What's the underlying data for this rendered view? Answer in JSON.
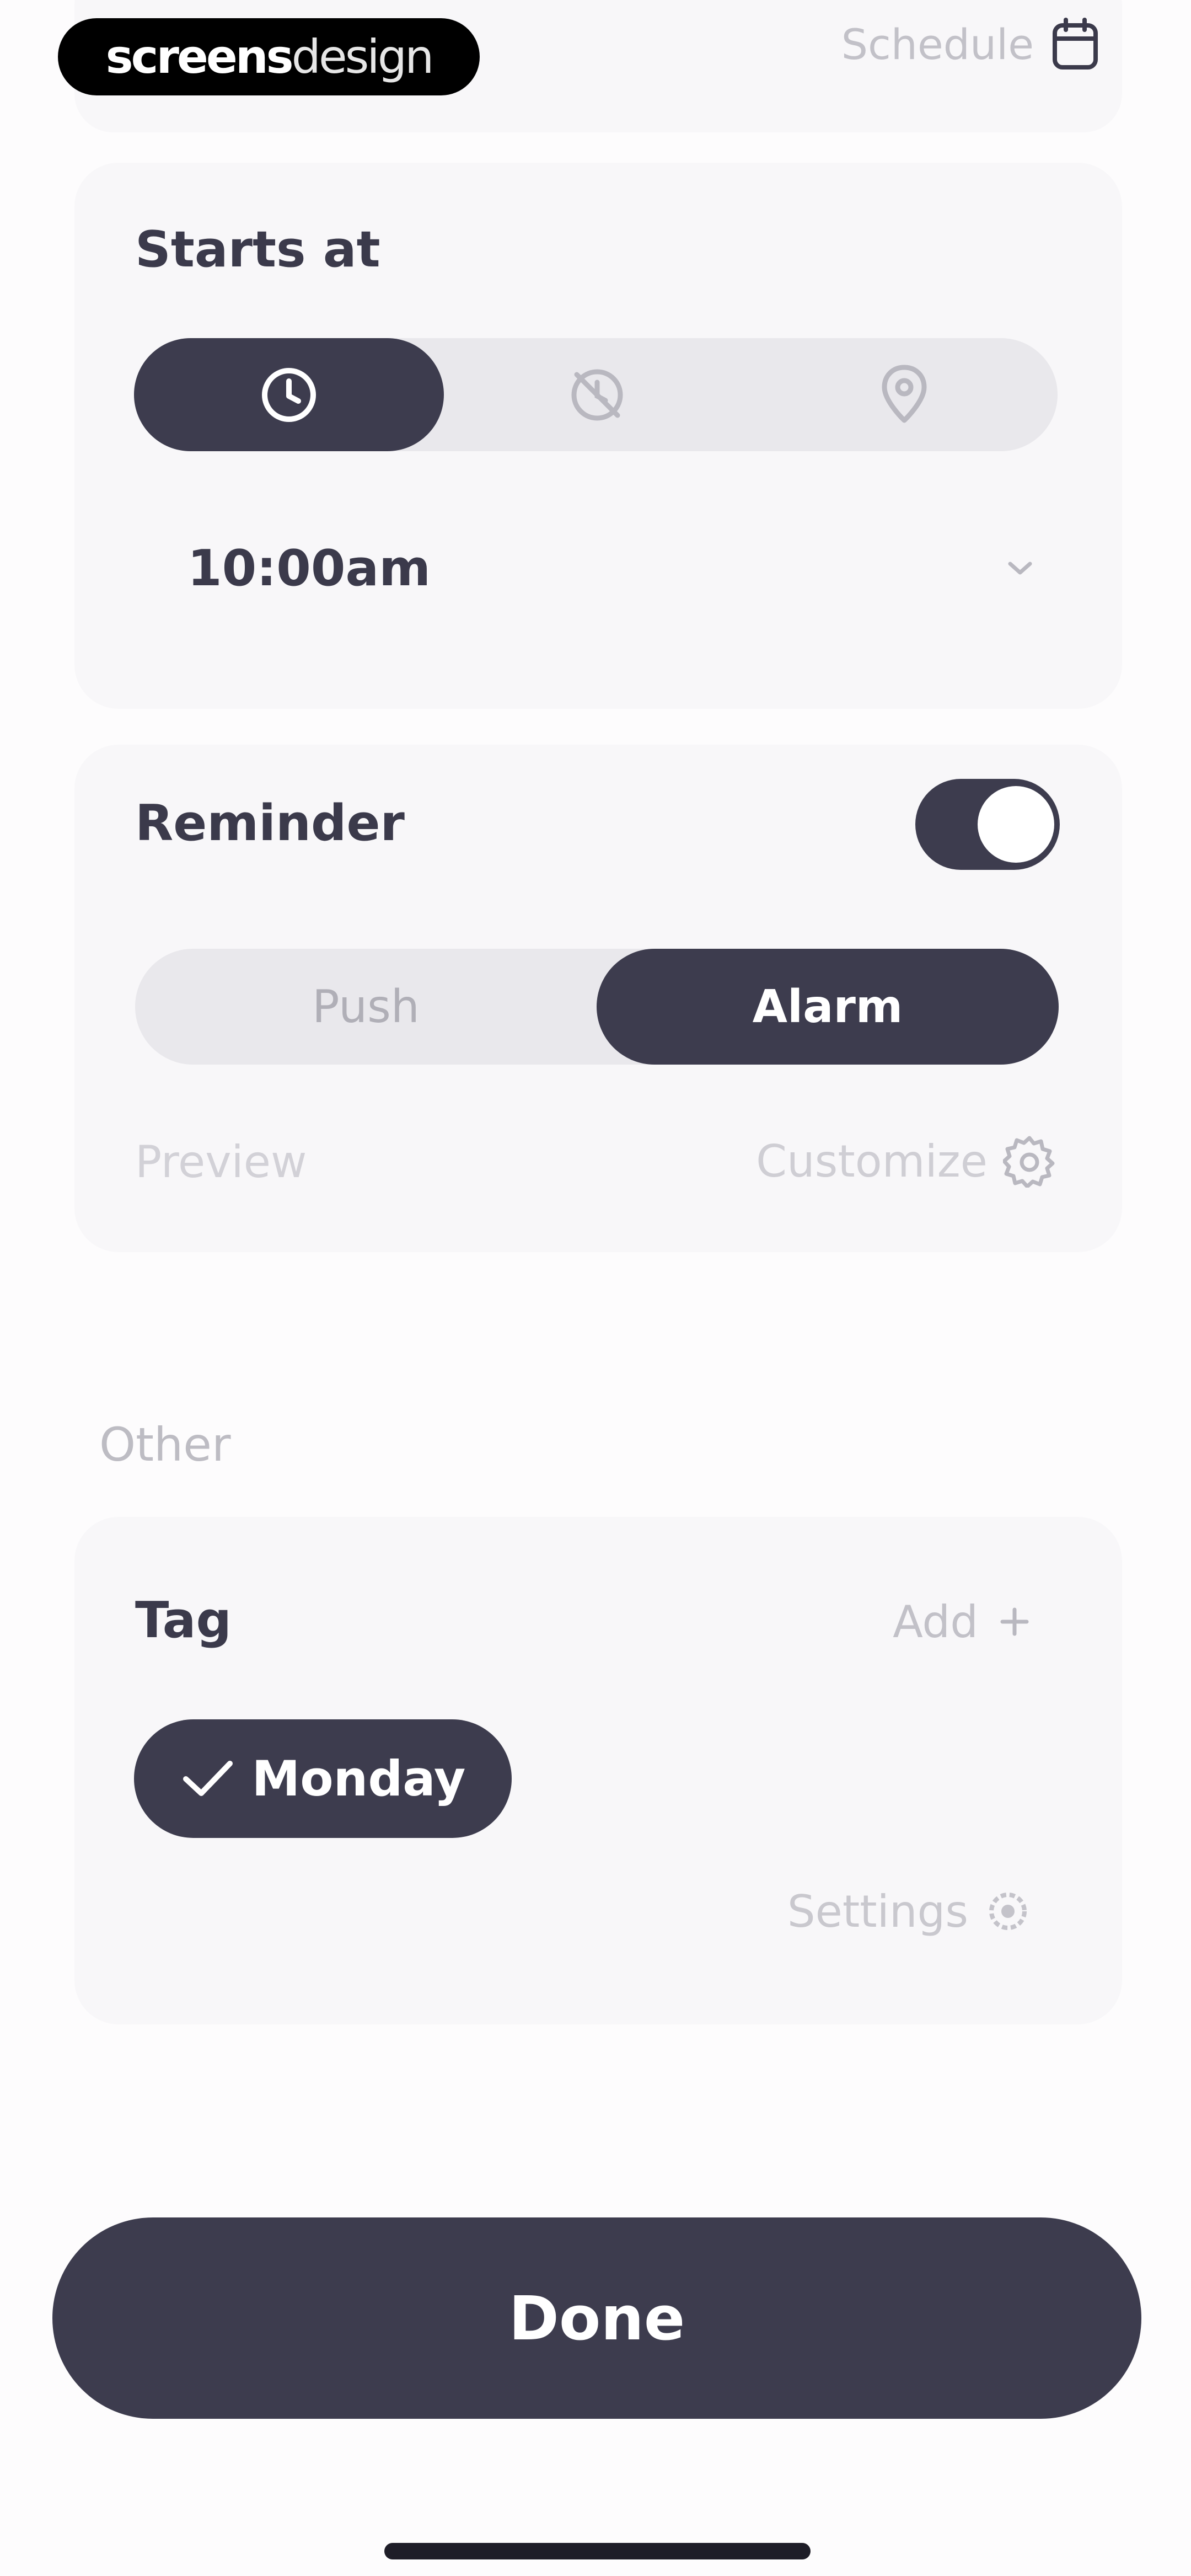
{
  "header": {
    "logo_bold": "screens",
    "logo_light": "design",
    "schedule_label": "Schedule",
    "schedule_icon": "calendar-icon"
  },
  "starts_at": {
    "title": "Starts at",
    "modes": [
      {
        "icon": "clock-icon",
        "active": true
      },
      {
        "icon": "clock-off-icon",
        "active": false
      },
      {
        "icon": "location-pin-icon",
        "active": false
      }
    ],
    "time_value": "10:00am"
  },
  "reminder": {
    "title": "Reminder",
    "enabled": true,
    "options": [
      "Push",
      "Alarm"
    ],
    "selected": "Alarm",
    "preview_label": "Preview",
    "customize_label": "Customize"
  },
  "other": {
    "section_label": "Other",
    "tag_title": "Tag",
    "add_label": "Add",
    "tags": [
      "Monday"
    ],
    "settings_label": "Settings"
  },
  "footer": {
    "done_label": "Done"
  },
  "colors": {
    "accent_dark": "#3d3c4e",
    "card_bg": "#f8f7f9",
    "segment_bg": "#e9e8ec",
    "muted_text": "#c7c6cd"
  }
}
